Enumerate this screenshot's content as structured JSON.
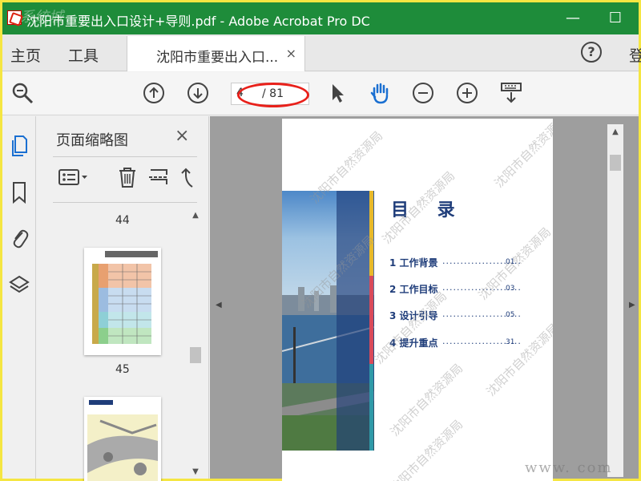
{
  "window": {
    "title": "沈阳市重要出入口设计+导则.pdf - Adobe Acrobat Pro DC",
    "watermark_logo": "系统城",
    "minimize_glyph": "—",
    "maximize_glyph": "☐"
  },
  "menubar": {
    "home": "主页",
    "tools": "工具",
    "tab_label": "沈阳市重要出入口...",
    "tab_close": "×",
    "help": "?",
    "login": "登"
  },
  "toolbar": {
    "current_page": "4",
    "total_pages": "/ 81",
    "icons": [
      "search-zoom-icon",
      "previous-page-icon",
      "next-page-icon",
      "select-pointer-icon",
      "hand-tool-icon",
      "zoom-out-icon",
      "zoom-in-icon",
      "keyboard-down-icon"
    ]
  },
  "sidebar": {
    "icons": [
      "pages-icon",
      "bookmark-icon",
      "attachment-icon",
      "layers-icon"
    ]
  },
  "thumbnails": {
    "panel_title": "页面缩略图",
    "close": "×",
    "labels": [
      "44",
      "45"
    ]
  },
  "document": {
    "toc_title": "目 录",
    "watermark": "沈阳市自然资源局",
    "items": [
      {
        "label": "1 工作背景",
        "page": "01"
      },
      {
        "label": "2 工作目标",
        "page": "03"
      },
      {
        "label": "3 设计引导",
        "page": "05"
      },
      {
        "label": "4 提升重点",
        "page": "31"
      }
    ],
    "dots": "......................",
    "stripe_colors": [
      "#e8b92a",
      "#d94a5a",
      "#2f9aa8"
    ],
    "dark_panel": "#1f3d7a"
  },
  "site_watermark": "www.        com",
  "colors": {
    "titlebar": "#1e8c3a",
    "accent_oval": "#e8201a",
    "icon_blue": "#1a6fd1"
  }
}
